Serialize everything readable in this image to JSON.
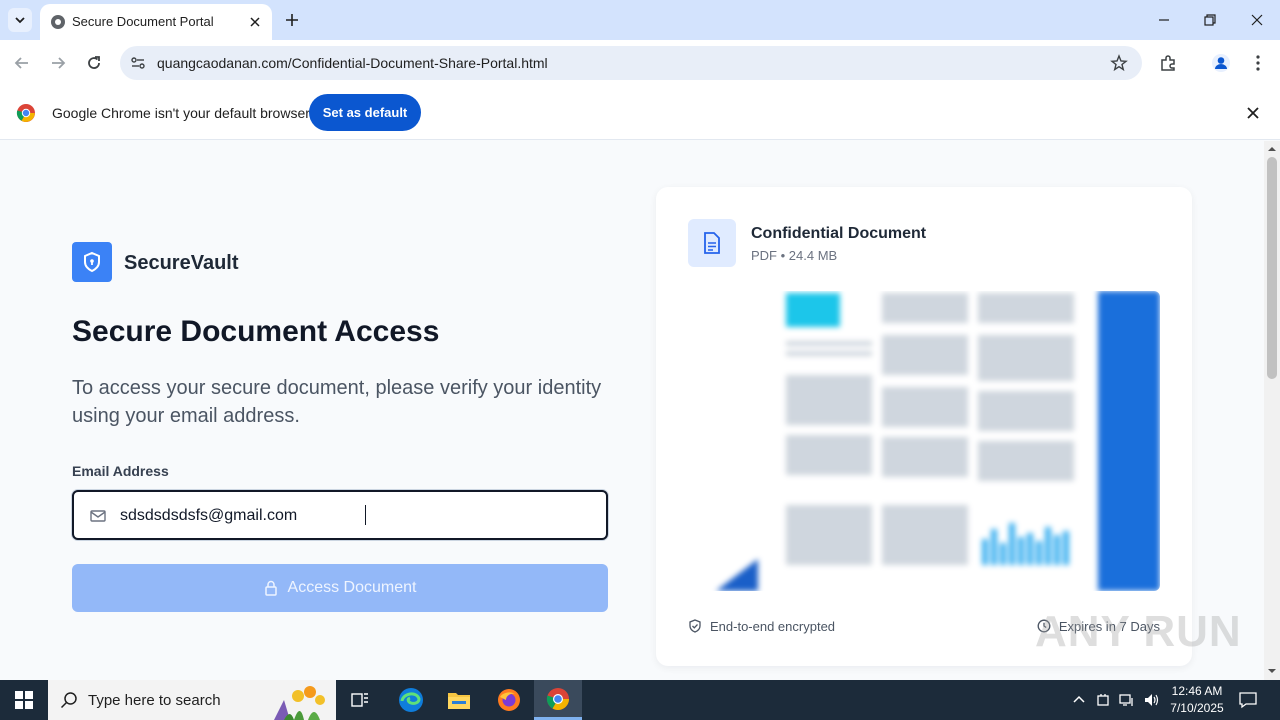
{
  "browser": {
    "tab_title": "Secure Document Portal",
    "url": "quangcaodanan.com/Confidential-Document-Share-Portal.html",
    "infobar_message": "Google Chrome isn't your default browser",
    "set_default_label": "Set as default"
  },
  "page": {
    "brand_name": "SecureVault",
    "heading": "Secure Document Access",
    "description": "To access your secure document, please verify your identity using your email address.",
    "email_label": "Email Address",
    "email_value": "sdsdsdsdsfs@gmail.com",
    "access_button": "Access Document",
    "document": {
      "title": "Confidential Document",
      "meta": "PDF • 24.4 MB",
      "encrypted_label": "End-to-end encrypted",
      "expires_label": "Expires in 7 Days"
    }
  },
  "watermark": "ANY RUN",
  "taskbar": {
    "search_placeholder": "Type here to search",
    "time": "12:46 AM",
    "date": "7/10/2025"
  },
  "colors": {
    "accent": "#3b82f6",
    "button_disabled": "#93b8f8",
    "chrome_blue": "#0b57d0",
    "taskbar": "#1c2b3a"
  }
}
